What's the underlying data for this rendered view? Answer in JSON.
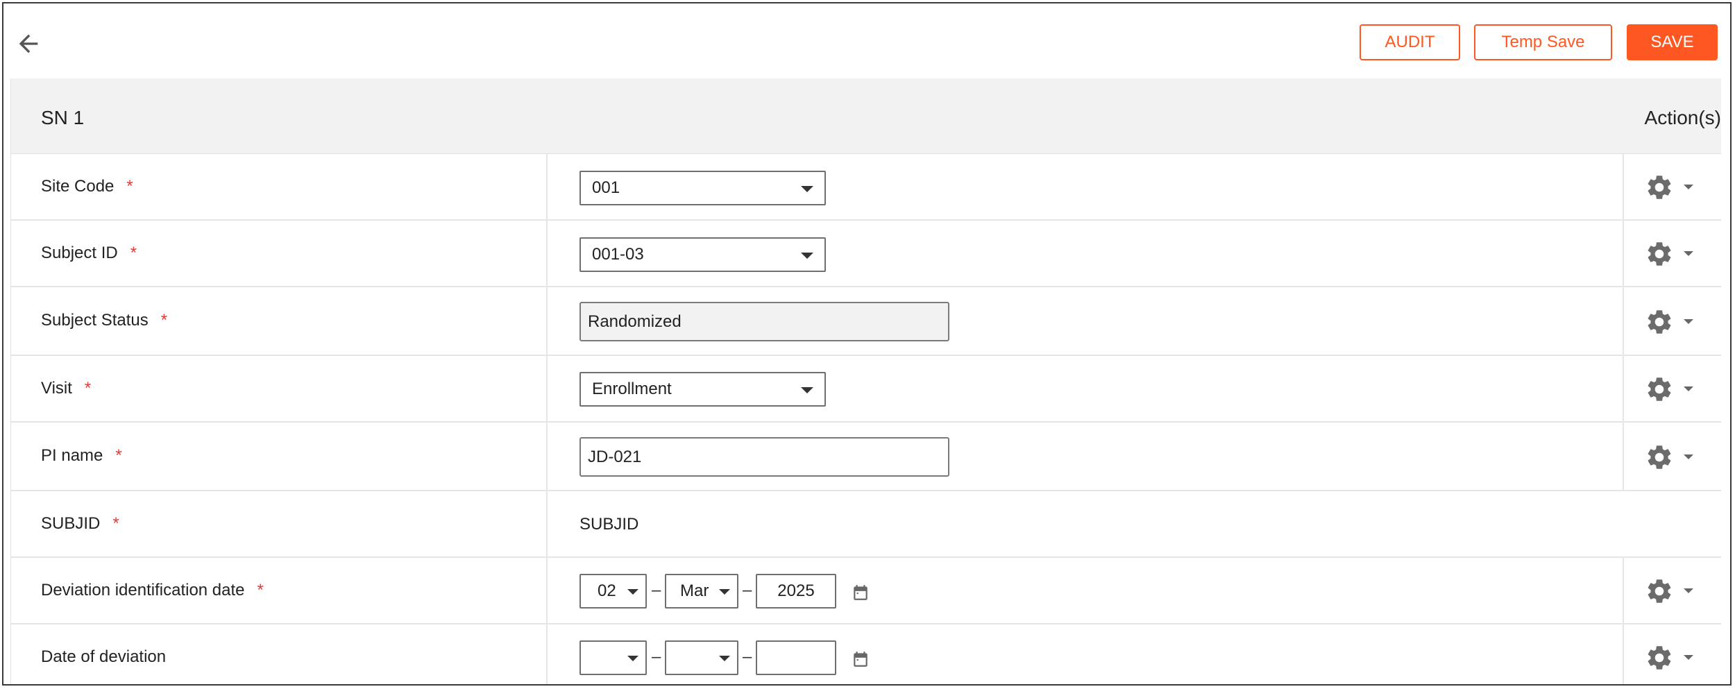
{
  "toolbar": {
    "audit_label": "AUDIT",
    "temp_save_label": "Temp Save",
    "save_label": "SAVE"
  },
  "table": {
    "header": {
      "title": "SN 1",
      "actions_label": "Action(s)"
    },
    "rows": [
      {
        "label": "Site Code",
        "required": "*",
        "value": "001"
      },
      {
        "label": "Subject ID",
        "required": "*",
        "value": "001-03"
      },
      {
        "label": "Subject Status",
        "required": "*",
        "value": "Randomized"
      },
      {
        "label": "Visit",
        "required": "*",
        "value": "Enrollment"
      },
      {
        "label": "PI name",
        "required": "*",
        "value": "JD-021"
      },
      {
        "label": "SUBJID",
        "required": "*",
        "value": "SUBJID"
      },
      {
        "label": "Deviation identification date",
        "required": "*",
        "day": "02",
        "month": "Mar",
        "year": "2025"
      },
      {
        "label": "Date of deviation",
        "day": "",
        "month": "",
        "year": ""
      }
    ],
    "date_separator": "–"
  },
  "colors": {
    "accent": "#ff5722",
    "required": "#e53935",
    "header_bg": "#f2f2f2"
  }
}
